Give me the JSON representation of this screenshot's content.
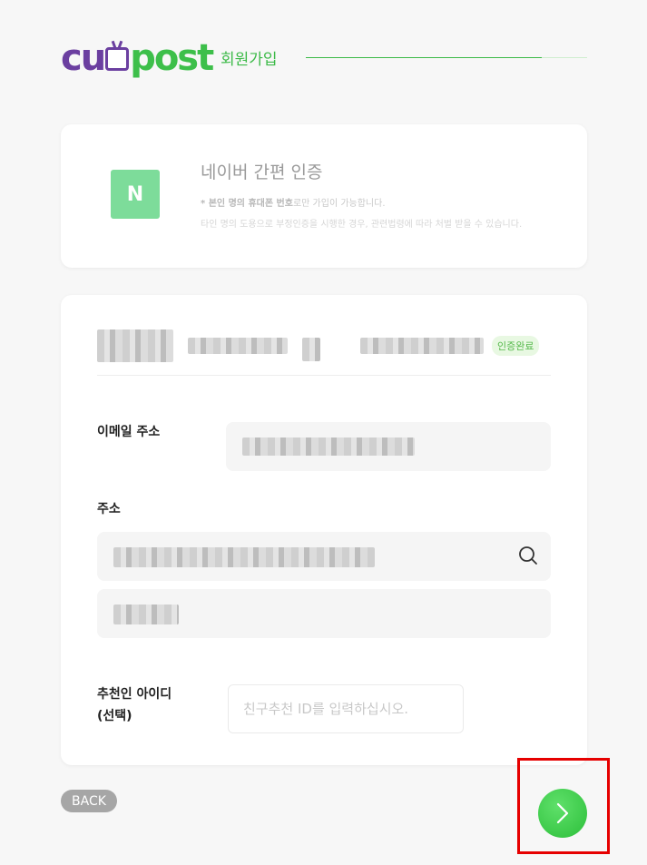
{
  "header": {
    "logo_left": "cu",
    "logo_right": "post",
    "title": "회원가입"
  },
  "naver": {
    "logo_letter": "N",
    "title": "네이버 간편 인증",
    "note_bold": "* 본인 명의 휴대폰 번호",
    "note_rest": "로만 가입이 가능합니다.",
    "note_warning": "타인 명의 도용으로 부정인증을 시행한 경우, 관련법령에 따라 처벌 받을 수 있습니다."
  },
  "verified": {
    "badge": "인증완료"
  },
  "form": {
    "email_label": "이메일 주소",
    "address_label": "주소",
    "recommend_label_line1": "추천인 아이디",
    "recommend_label_line2": "(선택)",
    "recommend_placeholder": "친구추천 ID를 입력하십시오."
  },
  "footer": {
    "back_label": "BACK"
  },
  "colors": {
    "brand_purple": "#6b3fa0",
    "brand_green": "#3cba48",
    "naver_green": "#7ddc9a",
    "highlight": "#e60000"
  },
  "icons": {
    "search": "search-icon",
    "next": "chevron-right-icon"
  }
}
